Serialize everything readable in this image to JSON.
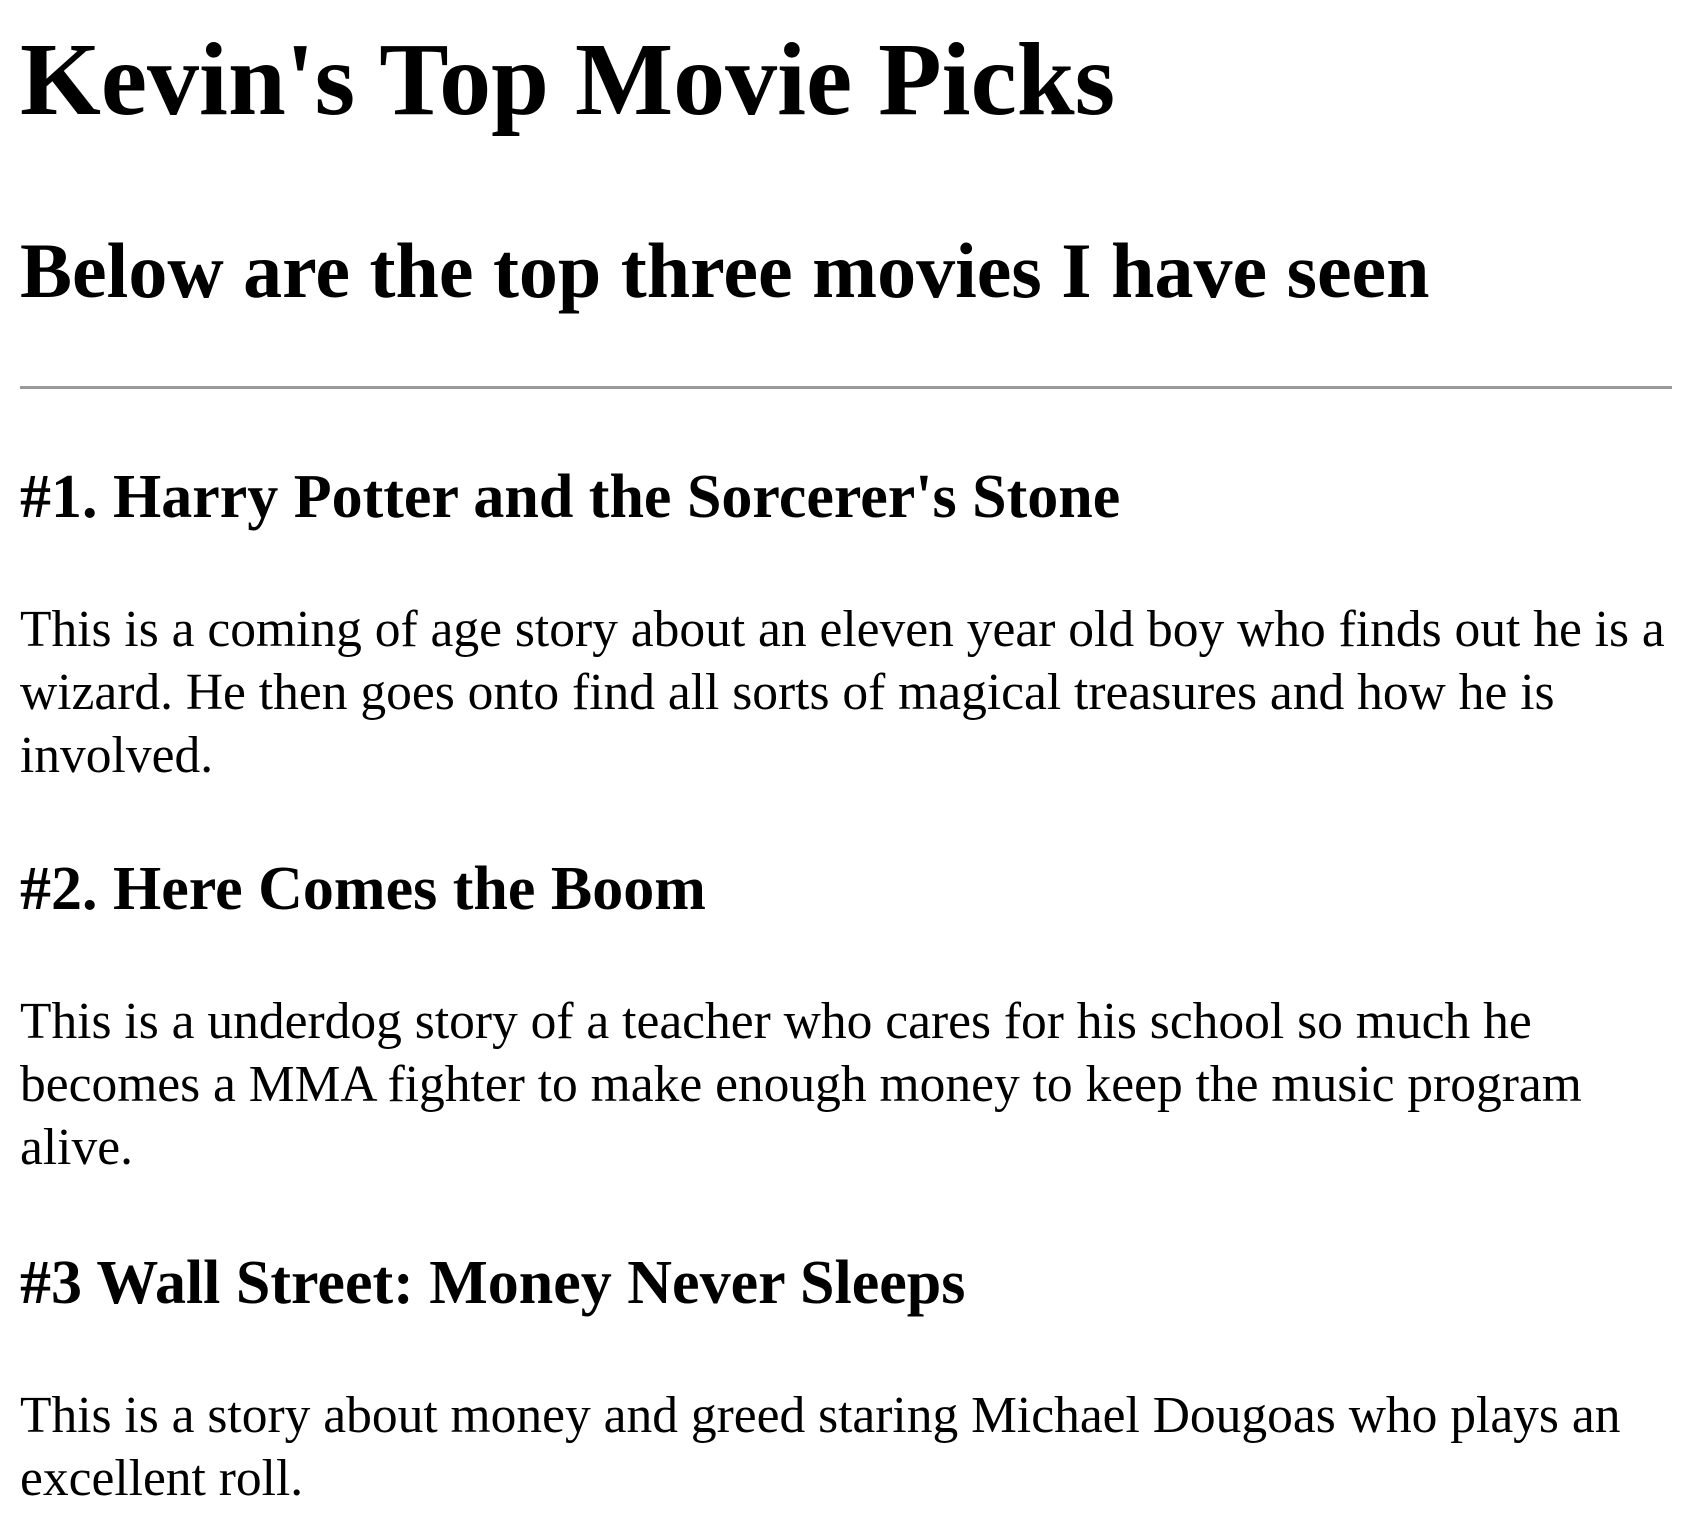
{
  "page": {
    "title": "Kevin's Top Movie Picks",
    "subtitle": "Below are the top three movies I have seen"
  },
  "movies": [
    {
      "heading": "#1. Harry Potter and the Sorcerer's Stone",
      "description": "This is a coming of age story about an eleven year old boy who finds out he is a wizard. He then goes onto find all sorts of magical treasures and how he is involved."
    },
    {
      "heading": "#2. Here Comes the Boom",
      "description": "This is a underdog story of a teacher who cares for his school so much he becomes a MMA fighter to make enough money to keep the music program alive."
    },
    {
      "heading": "#3 Wall Street: Money Never Sleeps",
      "description": "This is a story about money and greed staring Michael Dougoas who plays an excellent roll."
    }
  ]
}
